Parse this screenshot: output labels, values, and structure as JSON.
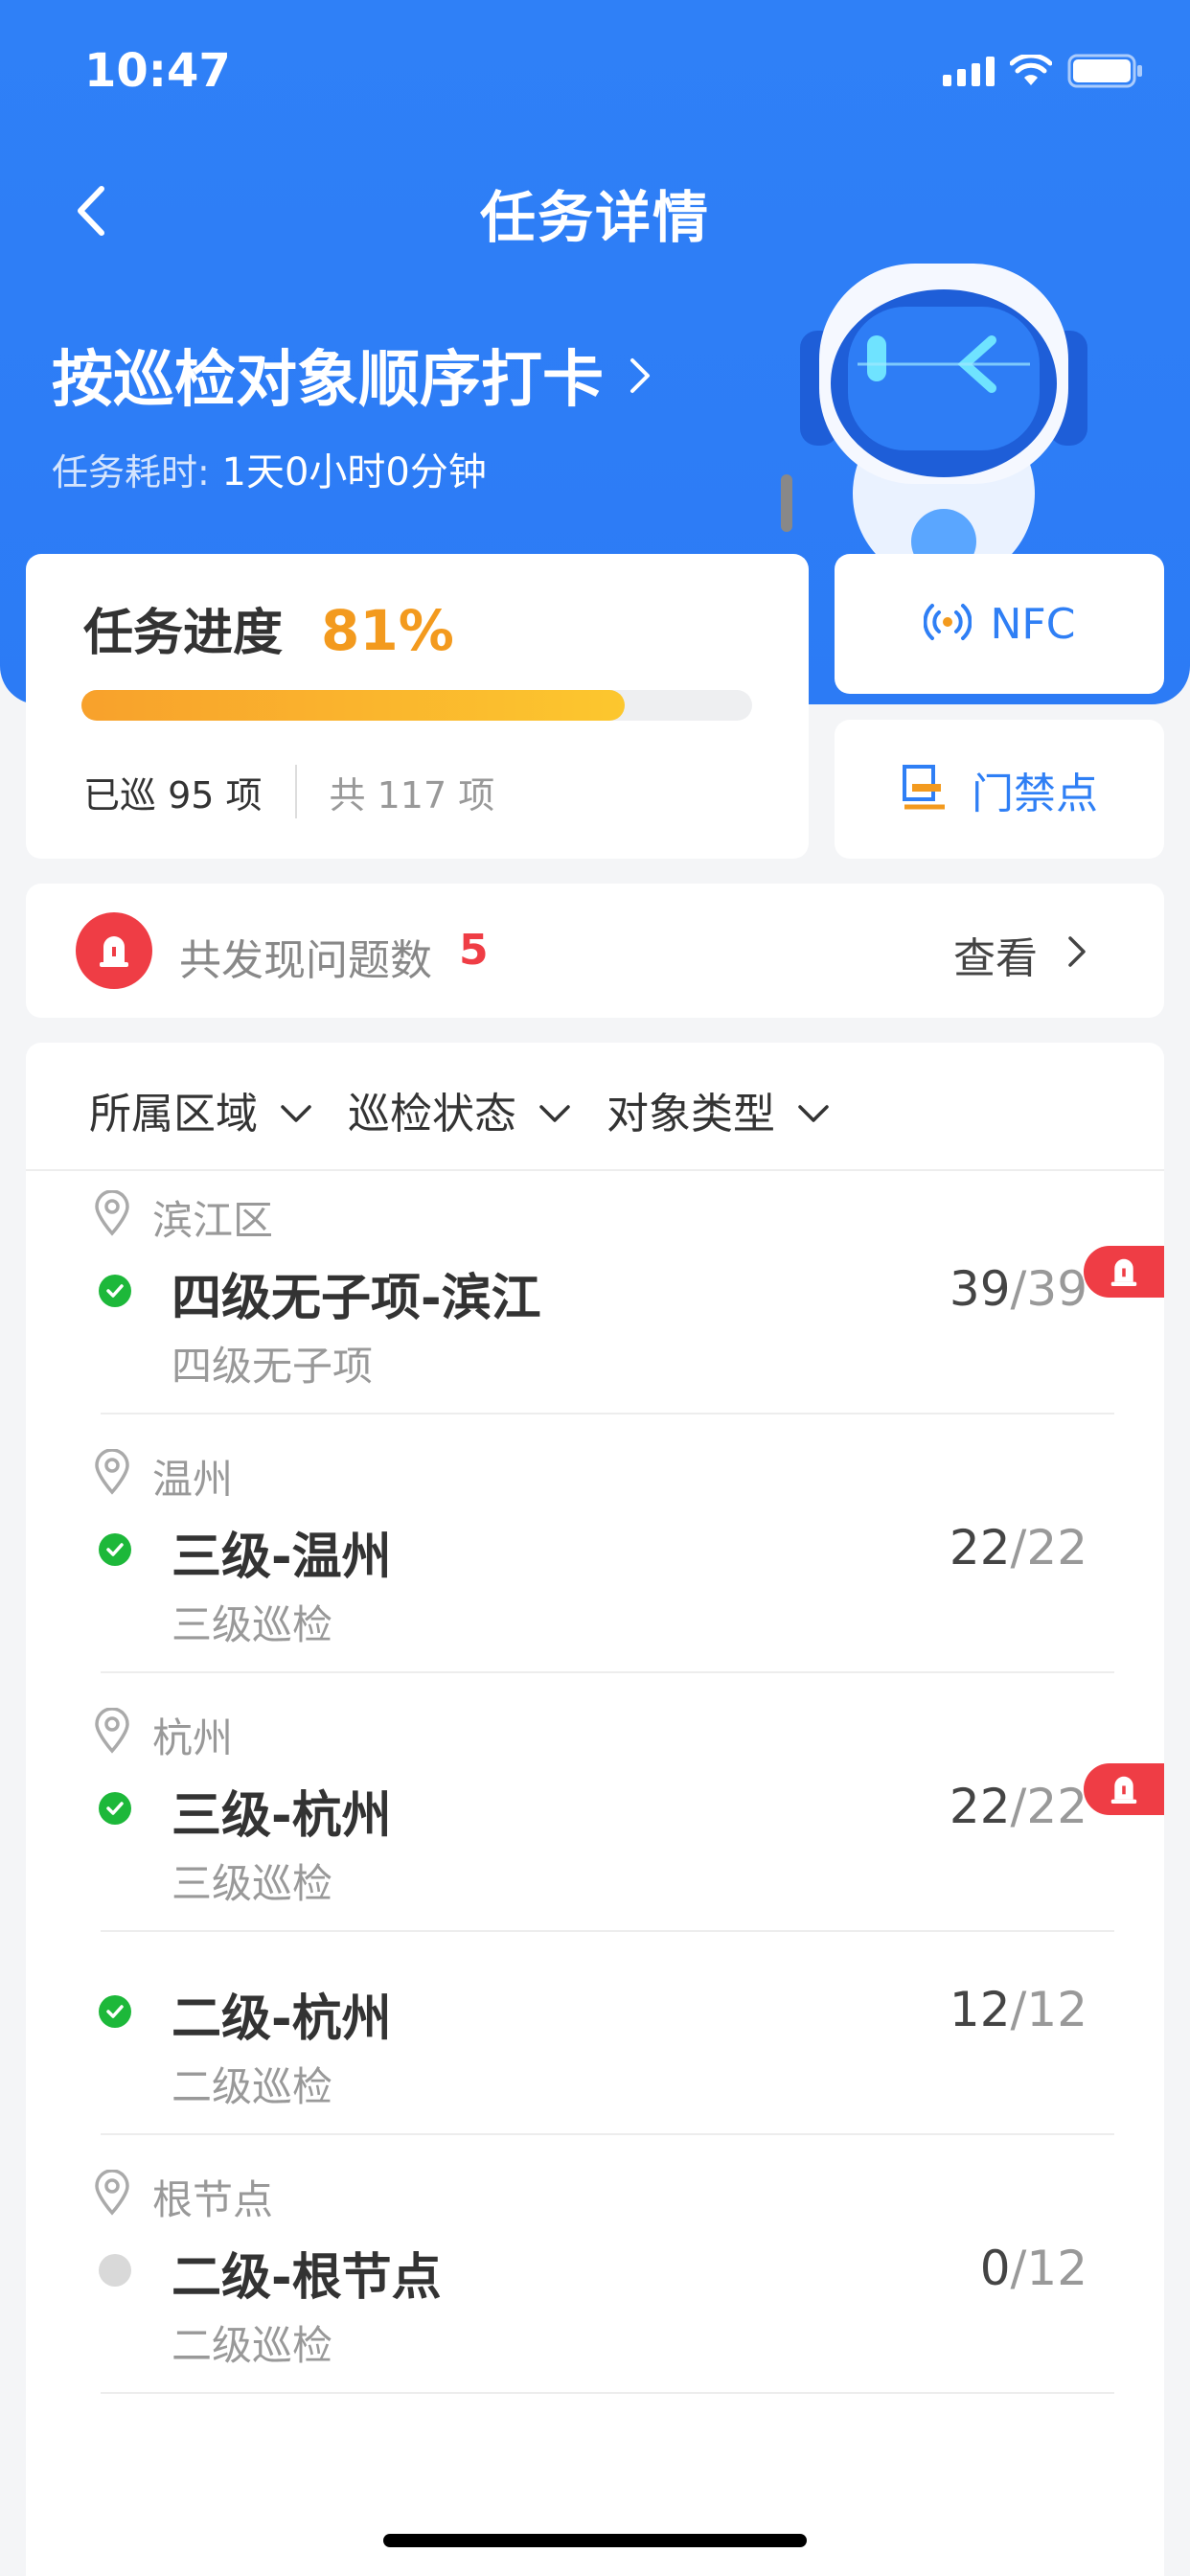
{
  "status_bar": {
    "time": "10:47"
  },
  "nav": {
    "title": "任务详情"
  },
  "task": {
    "name": "按巡检对象顺序打卡",
    "time_label": "任务耗时:",
    "time_value": "1天0小时0分钟"
  },
  "progress": {
    "label": "任务进度",
    "percent_text": "81%",
    "percent_value": 81,
    "checked_text": "已巡 95 项",
    "total_text": "共 117 项"
  },
  "side_buttons": {
    "nfc_label": "NFC",
    "door_label": "门禁点"
  },
  "issues": {
    "label": "共发现问题数",
    "count": "5",
    "view_label": "查看"
  },
  "filters": [
    "所属区域",
    "巡检状态",
    "对象类型"
  ],
  "groups": [
    {
      "region": "滨江区",
      "items": [
        {
          "name": "四级无子项-滨江",
          "sub": "四级无子项",
          "done": "39",
          "total": "/39",
          "status": "done",
          "flag": true
        }
      ]
    },
    {
      "region": "温州",
      "items": [
        {
          "name": "三级-温州",
          "sub": "三级巡检",
          "done": "22",
          "total": "/22",
          "status": "done",
          "flag": false
        }
      ]
    },
    {
      "region": "杭州",
      "items": [
        {
          "name": "三级-杭州",
          "sub": "三级巡检",
          "done": "22",
          "total": "/22",
          "status": "done",
          "flag": true
        },
        {
          "name": "二级-杭州",
          "sub": "二级巡检",
          "done": "12",
          "total": "/12",
          "status": "done",
          "flag": false
        }
      ]
    },
    {
      "region": "根节点",
      "items": [
        {
          "name": "二级-根节点",
          "sub": "二级巡检",
          "done": "0",
          "total": "/12",
          "status": "pending",
          "flag": false
        }
      ]
    }
  ],
  "colors": {
    "brand_blue": "#2F80F7",
    "accent_orange": "#F39A1E",
    "alert_red": "#EF3D45",
    "ok_green": "#1DB83A"
  }
}
